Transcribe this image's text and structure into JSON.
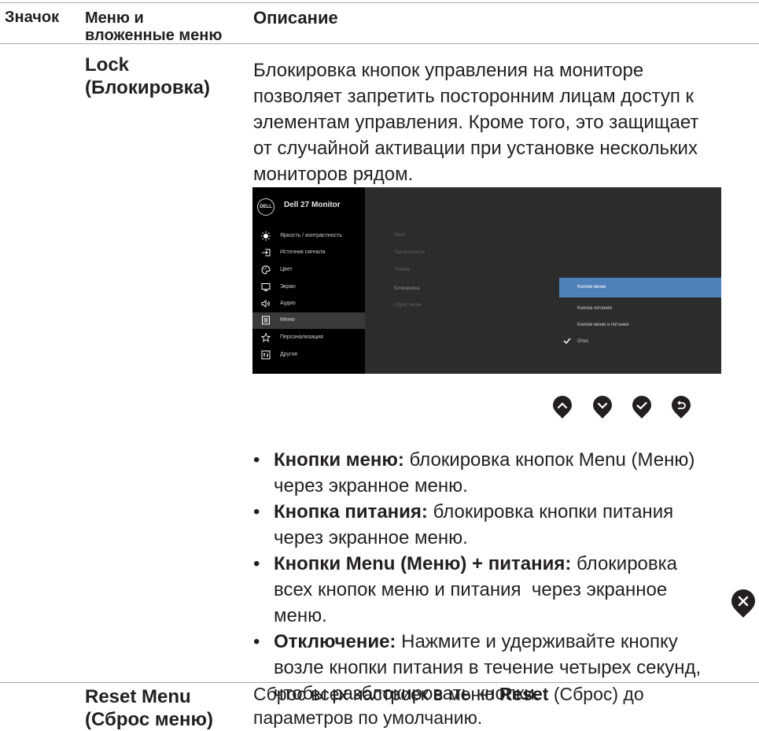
{
  "table": {
    "header": {
      "icon_col": "Значок",
      "menu_col_line1": "Меню и",
      "menu_col_line2": "вложенные меню",
      "desc_col": "Описание"
    },
    "rows": [
      {
        "sub_line1": "Lock",
        "sub_line2": "(Блокировка)",
        "desc_lines": [
          "Блокировка кнопок управления на мониторе",
          "позволяет запретить посторонним лицам доступ к",
          "элементам управления. Кроме того, это защищает",
          "от случайной активации при установке нескольких",
          "мониторов рядом."
        ]
      },
      {
        "sub_line1": "Reset Menu",
        "sub_line2": "(Сброс меню)",
        "desc_pre": "Сброс всех настроек в меню ",
        "desc_bold": "Reset",
        "desc_post": " (Сброс) до",
        "desc_line2": "параметров по умолчанию."
      }
    ]
  },
  "osd": {
    "logo": "DELL",
    "title": "Dell 27 Monitor",
    "menu_items": [
      {
        "label": "Яркость / контрастность",
        "icon": "brightness-icon"
      },
      {
        "label": "Источник сигнала",
        "icon": "input-source-icon"
      },
      {
        "label": "Цвет",
        "icon": "palette-icon"
      },
      {
        "label": "Экран",
        "icon": "display-icon"
      },
      {
        "label": "Аудио",
        "icon": "audio-icon"
      },
      {
        "label": "Меню",
        "icon": "menu-icon",
        "selected": true
      },
      {
        "label": "Персонализация",
        "icon": "star-icon"
      },
      {
        "label": "Другое",
        "icon": "other-icon"
      }
    ],
    "sub_items": [
      "Язык",
      "Прозрачность",
      "Таймер",
      "Блокировка",
      "Сброс меню"
    ],
    "options": [
      {
        "label": "Кнопки меню",
        "highlighted": true
      },
      {
        "label": "Кнопка питания"
      },
      {
        "label": "Кнопки меню и питания"
      },
      {
        "label": "Откл.",
        "checked": true
      }
    ]
  },
  "nav_buttons": [
    "up-icon",
    "down-icon",
    "check-icon",
    "back-icon"
  ],
  "bullets": [
    {
      "bold": "Кнопки меню:",
      "l1": " блокировка кнопок Menu (Меню)",
      "l2": "через экранное меню."
    },
    {
      "bold": "Кнопка питания:",
      "l1": " блокировка кнопки питания",
      "l2": "через экранное меню."
    },
    {
      "bold": "Кнопки Menu (Меню) + питания:",
      "l1": " блокировка",
      "l2": "всех кнопок меню и питания  через экранное",
      "l3": "меню."
    },
    {
      "bold": "Отключение:",
      "l1": " Нажмите и удерживайте кнопку",
      "l2": "возле кнопки питания в течение четырех секунд,",
      "l3": "чтобы разблокировать кнопки."
    }
  ],
  "colors": {
    "highlight": "#4f80b9",
    "osd_bg": "#2c2c2c",
    "rule": "#a7a9ac"
  }
}
